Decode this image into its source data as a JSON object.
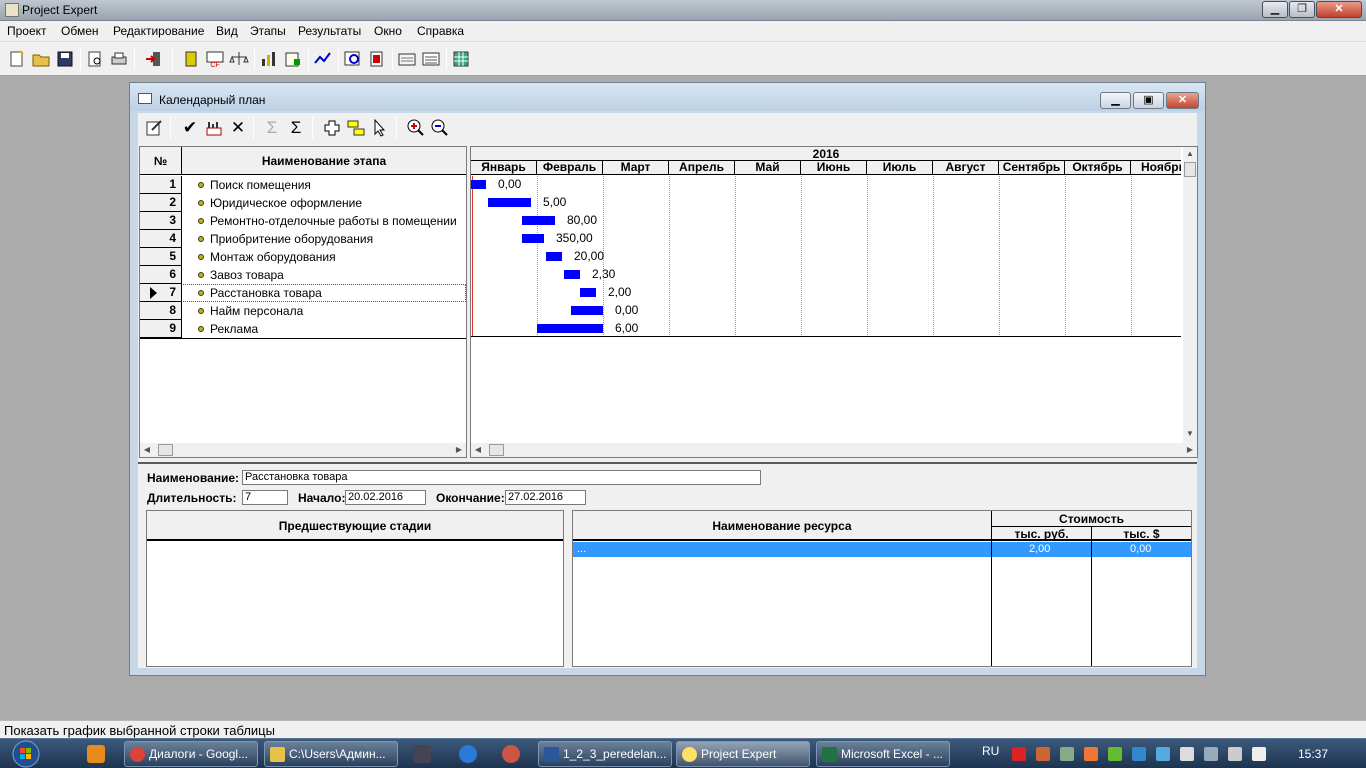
{
  "app": {
    "title": "Project Expert"
  },
  "menu": [
    "Проект",
    "Обмен",
    "Редактирование",
    "Вид",
    "Этапы",
    "Результаты",
    "Окно",
    "Справка"
  ],
  "window": {
    "title": "Календарный план"
  },
  "grid": {
    "col_num": "№",
    "col_name": "Наименование этапа",
    "rows": [
      {
        "num": "1",
        "name": "Поиск помещения"
      },
      {
        "num": "2",
        "name": "Юридическое оформление"
      },
      {
        "num": "3",
        "name": "Ремонтно-отделочные работы в помещении"
      },
      {
        "num": "4",
        "name": "Приобритение оборудования"
      },
      {
        "num": "5",
        "name": "Монтаж оборудования"
      },
      {
        "num": "6",
        "name": "Завоз товара"
      },
      {
        "num": "7",
        "name": "Расстановка товара"
      },
      {
        "num": "8",
        "name": "Найм персонала"
      },
      {
        "num": "9",
        "name": "Реклама"
      }
    ],
    "selected_row": 7
  },
  "gantt": {
    "year": "2016",
    "months": [
      "Январь",
      "Февраль",
      "Март",
      "Апрель",
      "Май",
      "Июнь",
      "Июль",
      "Август",
      "Сентябрь",
      "Октябрь",
      "Ноябрь"
    ],
    "bars": [
      {
        "start": "01.01.2016",
        "end": "08.01.2016",
        "label": "0,00"
      },
      {
        "start": "09.01.2016",
        "end": "29.01.2016",
        "label": "5,00"
      },
      {
        "start": "25.01.2016",
        "end": "09.02.2016",
        "label": "80,00"
      },
      {
        "start": "25.01.2016",
        "end": "04.02.2016",
        "label": "350,00"
      },
      {
        "start": "05.02.2016",
        "end": "12.02.2016",
        "label": "20,00"
      },
      {
        "start": "13.02.2016",
        "end": "20.02.2016",
        "label": "2,30"
      },
      {
        "start": "20.02.2016",
        "end": "27.02.2016",
        "label": "2,00"
      },
      {
        "start": "16.02.2016",
        "end": "01.03.2016",
        "label": "0,00"
      },
      {
        "start": "01.02.2016",
        "end": "01.03.2016",
        "label": "6,00"
      }
    ]
  },
  "form": {
    "name_label": "Наименование:",
    "name_value": "Расстановка товара",
    "duration_label": "Длительность:",
    "duration_value": "7",
    "start_label": "Начало:",
    "start_value": "20.02.2016",
    "end_label": "Окончание:",
    "end_value": "27.02.2016"
  },
  "predecessors": {
    "header": "Предшествующие стадии"
  },
  "resources": {
    "col_name": "Наименование ресурса",
    "col_cost": "Стоимость",
    "col_rub": "тыс. руб.",
    "col_usd": "тыс. $",
    "row": {
      "name": "...",
      "rub": "2,00",
      "usd": "0,00"
    }
  },
  "status": {
    "text": "Показать график выбранной строки таблицы"
  },
  "taskbar": {
    "tasks": [
      "Диалоги - Googl...",
      "C:\\Users\\Админ...",
      "1_2_3_peredelan...",
      "Project Expert",
      "Microsoft Excel - ..."
    ],
    "lang": "RU",
    "clock": "15:37"
  },
  "colors": {
    "bar": "#0000ff",
    "selection": "#3399ff"
  }
}
